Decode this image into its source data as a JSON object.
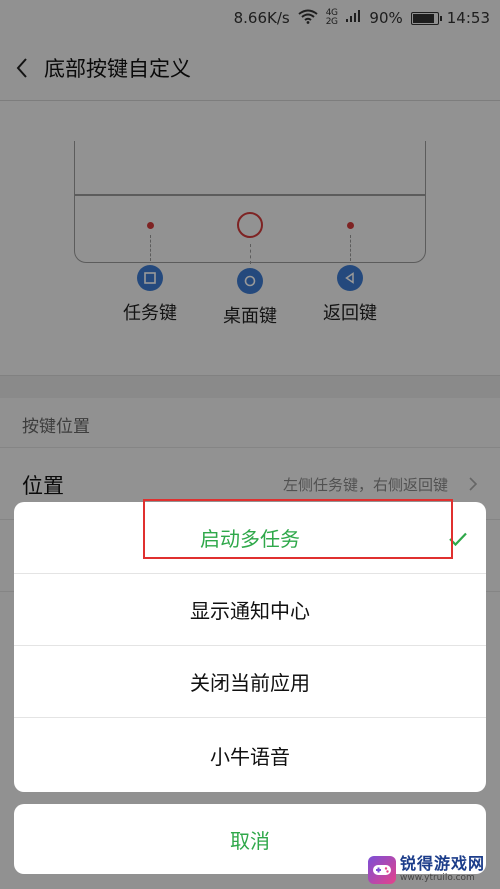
{
  "status_bar": {
    "speed": "8.66K/s",
    "net_4g": "4G",
    "net_2g": "2G",
    "battery": "90%",
    "battery_level": 0.9,
    "time": "14:53"
  },
  "header": {
    "title": "底部按键自定义"
  },
  "diagram": {
    "keys": [
      {
        "label": "任务键",
        "icon": "square-icon"
      },
      {
        "label": "桌面键",
        "icon": "circle-icon"
      },
      {
        "label": "返回键",
        "icon": "triangle-left-icon"
      }
    ]
  },
  "section": {
    "label": "按键位置"
  },
  "position_row": {
    "title": "位置",
    "value": "左侧任务键，右侧返回键"
  },
  "sheet": {
    "options": [
      {
        "label": "启动多任务",
        "selected": true
      },
      {
        "label": "显示通知中心"
      },
      {
        "label": "关闭当前应用"
      },
      {
        "label": "小牛语音"
      }
    ],
    "cancel": "取消"
  },
  "colors": {
    "accent_green": "#2fa84a",
    "key_blue": "#3d7bd0",
    "marker_red": "#d23b3b",
    "highlight": "#e0302f"
  },
  "watermark": {
    "name": "锐得游戏网",
    "url": "www.ytruilo.com"
  }
}
